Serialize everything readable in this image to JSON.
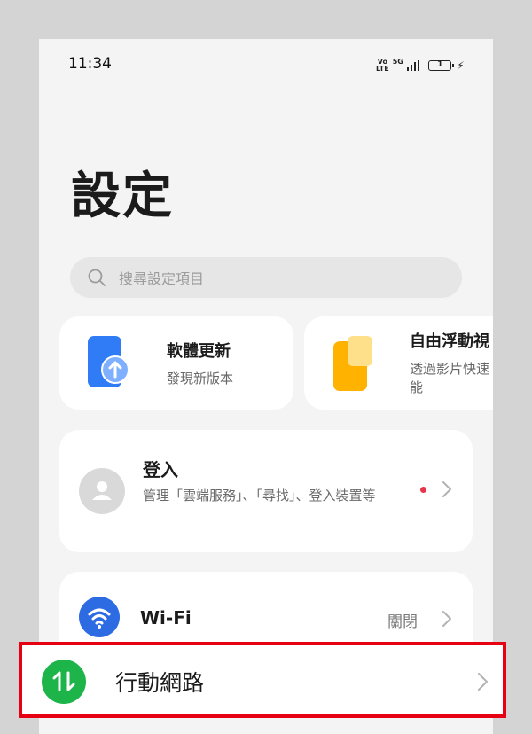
{
  "status_bar": {
    "time": "11:34",
    "volte_line1": "Vo",
    "volte_line2": "LTE",
    "network": "5G",
    "battery_level": "1"
  },
  "page": {
    "title": "設定"
  },
  "search": {
    "placeholder": "搜尋設定項目"
  },
  "promo_cards": [
    {
      "title": "軟體更新",
      "subtitle": "發現新版本",
      "icon": "software-update-icon"
    },
    {
      "title": "自由浮動視",
      "subtitle": "透過影片快速能",
      "icon": "floating-window-icon"
    }
  ],
  "login": {
    "title": "登入",
    "subtitle": "管理「雲端服務」、「尋找」、登入裝置等",
    "icon": "avatar-icon"
  },
  "wifi": {
    "label": "Wi-Fi",
    "status": "關閉",
    "icon": "wifi-icon"
  },
  "mobile_network": {
    "label": "行動網路",
    "icon": "mobile-data-icon"
  },
  "colors": {
    "accent_blue": "#2d6be2",
    "mobile_green": "#1db54a",
    "notification_red": "#e8344a",
    "highlight_red": "#e60012"
  }
}
